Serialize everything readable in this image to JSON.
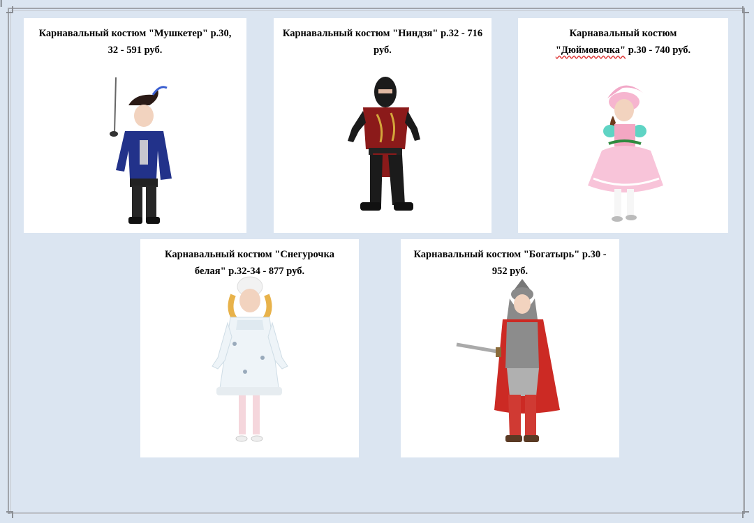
{
  "cards": [
    {
      "caption": "Карнавальный костюм \"Мушкетер\" р.30, 32 - 591 руб.",
      "figure_icon": "musketeer-costume-child"
    },
    {
      "caption": "Карнавальный костюм \"Ниндзя\" р.32 - 716 руб.",
      "figure_icon": "ninja-costume-child"
    },
    {
      "caption_before": "Карнавальный костюм",
      "caption_underlined": "\"Дюймовочка\"",
      "caption_after": " р.30 - 740 руб.",
      "figure_icon": "thumbelina-costume-child"
    },
    {
      "caption": "Карнавальный костюм \"Снегурочка белая\" р.32-34 - 877 руб.",
      "figure_icon": "snow-maiden-costume-child"
    },
    {
      "caption": "Карнавальный костюм \"Богатырь\" р.30  - 952 руб.",
      "figure_icon": "bogatyr-costume-child"
    }
  ],
  "colors": {
    "page_background": "#dbe5f1",
    "card_background": "#ffffff",
    "frame": "#a0a4ab"
  }
}
